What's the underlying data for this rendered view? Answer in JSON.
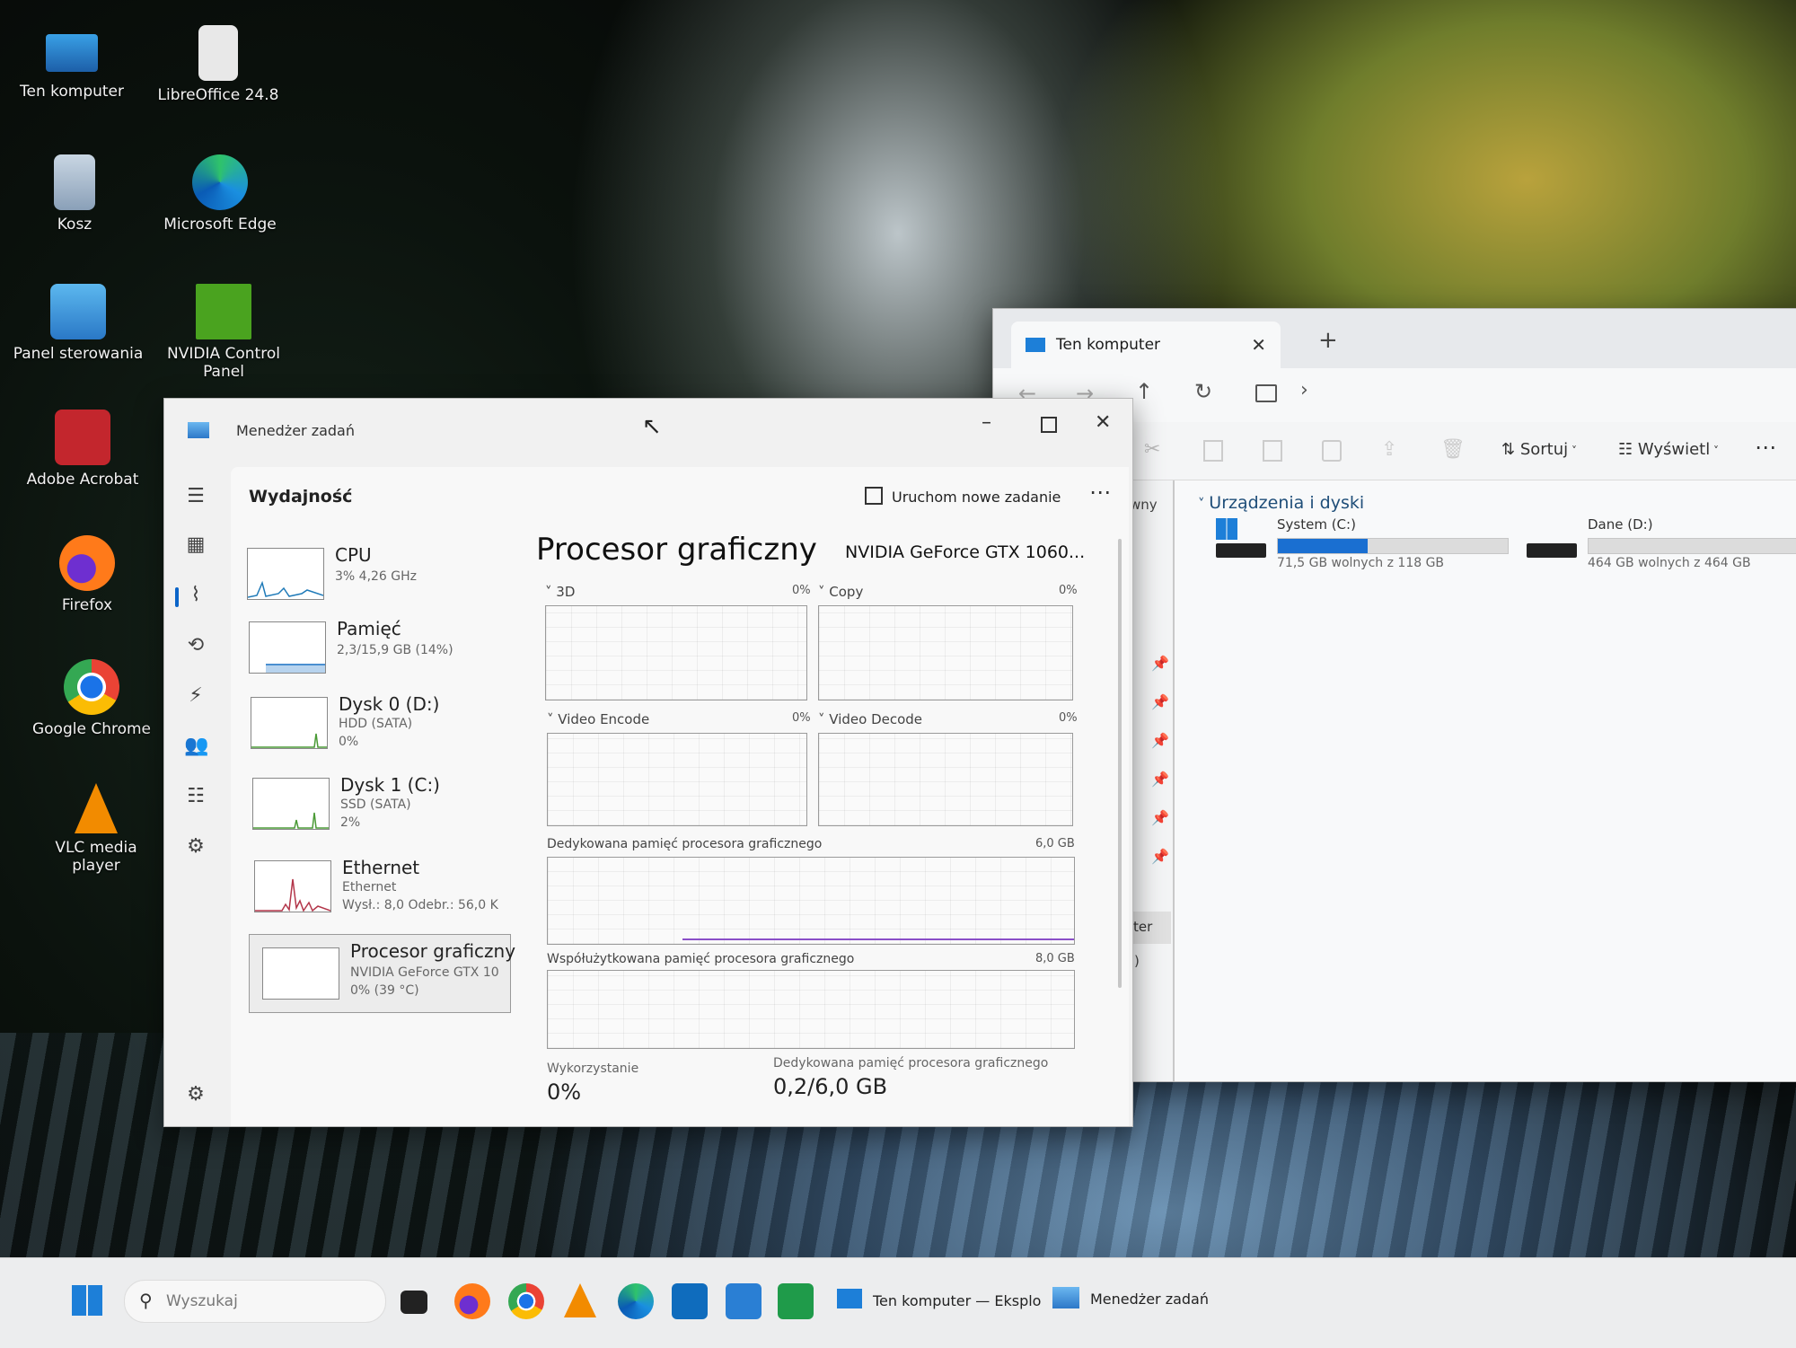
{
  "desktop": {
    "icons": [
      {
        "label": "Ten komputer",
        "icon": "monitor-icon"
      },
      {
        "label": "LibreOffice 24.8",
        "icon": "libreoffice-icon"
      },
      {
        "label": "Kosz",
        "icon": "recycle-bin-icon"
      },
      {
        "label": "Microsoft Edge",
        "icon": "edge-icon"
      },
      {
        "label": "Panel sterowania",
        "icon": "control-panel-icon"
      },
      {
        "label": "NVIDIA Control Panel",
        "icon": "nvidia-icon"
      },
      {
        "label": "Adobe Acrobat",
        "icon": "acrobat-icon"
      },
      {
        "label": "Firefox",
        "icon": "firefox-icon"
      },
      {
        "label": "Google Chrome",
        "icon": "chrome-icon"
      },
      {
        "label": "VLC media player",
        "icon": "vlc-icon"
      }
    ]
  },
  "explorer": {
    "tab_title": "Ten komputer",
    "new_tab": "+",
    "toolbar": {
      "sort_label": "Sortuj",
      "view_label": "Wyświetl",
      "more": "⋯"
    },
    "sidebar_fragments": [
      "wny",
      "ter",
      ":)"
    ],
    "section_title": "Urządzenia i dyski",
    "drives": [
      {
        "name": "System (C:)",
        "free": "71,5 GB wolnych z 118 GB",
        "used_fraction": 0.39
      },
      {
        "name": "Dane (D:)",
        "free": "464 GB wolnych z 464 GB",
        "used_fraction": 0.0
      }
    ]
  },
  "taskmgr": {
    "title": "Menedżer zadań",
    "section": "Wydajność",
    "new_task": "Uruchom nowe zadanie",
    "more": "⋯",
    "items": [
      {
        "name": "CPU",
        "sub1": "3% 4,26 GHz",
        "sub2": "",
        "sub3": ""
      },
      {
        "name": "Pamięć",
        "sub1": "2,3/15,9 GB (14%)",
        "sub2": "",
        "sub3": ""
      },
      {
        "name": "Dysk 0 (D:)",
        "sub1": "HDD (SATA)",
        "sub2": "0%",
        "sub3": ""
      },
      {
        "name": "Dysk 1 (C:)",
        "sub1": "SSD (SATA)",
        "sub2": "2%",
        "sub3": ""
      },
      {
        "name": "Ethernet",
        "sub1": "Ethernet",
        "sub2": "Wysł.: 8,0 Odebr.: 56,0 K",
        "sub3": ""
      },
      {
        "name": "Procesor graficzny",
        "sub1": "NVIDIA GeForce GTX 10",
        "sub2": "0% (39 °C)",
        "sub3": ""
      }
    ],
    "gpu": {
      "title": "Procesor graficzny",
      "model": "NVIDIA GeForce GTX 1060...",
      "engines": [
        {
          "label": "3D",
          "pct": "0%"
        },
        {
          "label": "Copy",
          "pct": "0%"
        },
        {
          "label": "Video Encode",
          "pct": "0%"
        },
        {
          "label": "Video Decode",
          "pct": "0%"
        }
      ],
      "dedicated_label": "Dedykowana pamięć procesora graficznego",
      "dedicated_max": "6,0 GB",
      "shared_label": "Współużytkowana pamięć procesora graficznego",
      "shared_max": "8,0 GB",
      "stat_usage_label": "Wykorzystanie",
      "stat_usage_value": "0%",
      "stat_dedicated_label": "Dedykowana pamięć procesora graficznego",
      "stat_dedicated_value": "0,2/6,0 GB"
    }
  },
  "taskbar": {
    "search_placeholder": "Wyszukaj",
    "explorer_label": "Ten komputer — Eksplo",
    "taskmgr_label": "Menedżer zadań"
  }
}
